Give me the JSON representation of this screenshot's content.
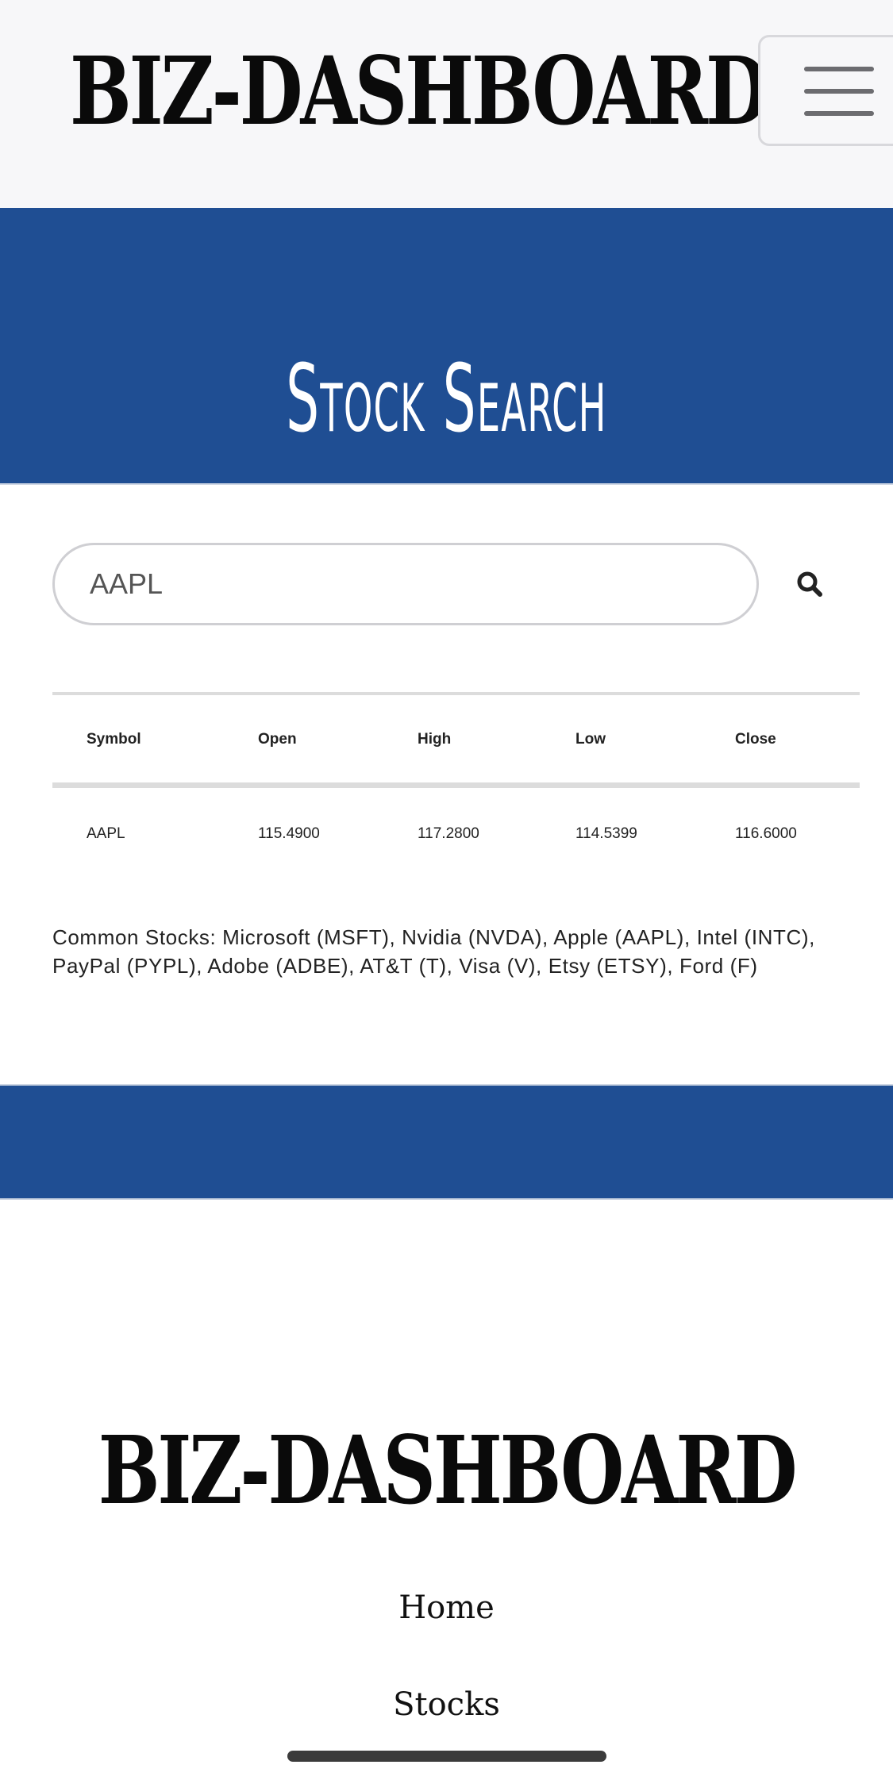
{
  "header": {
    "brand": "BIZ-DASHBOARD",
    "menu_icon": "hamburger-menu-icon"
  },
  "hero": {
    "title": "Stock Search"
  },
  "search": {
    "value": "AAPL",
    "icon": "search-icon"
  },
  "table": {
    "columns": [
      "Symbol",
      "Open",
      "High",
      "Low",
      "Close"
    ],
    "rows": [
      [
        "AAPL",
        "115.4900",
        "117.2800",
        "114.5399",
        "116.6000"
      ]
    ]
  },
  "common_stocks": "Common Stocks: Microsoft (MSFT), Nvidia (NVDA), Apple (AAPL), Intel (INTC), PayPal (PYPL), Adobe (ADBE), AT&T (T), Visa (V), Etsy (ETSY), Ford (F)",
  "footer": {
    "brand": "BIZ-DASHBOARD",
    "links": [
      "Home",
      "Stocks"
    ]
  },
  "colors": {
    "brand_blue": "#1f4e93",
    "header_bg": "#f7f7f9"
  }
}
